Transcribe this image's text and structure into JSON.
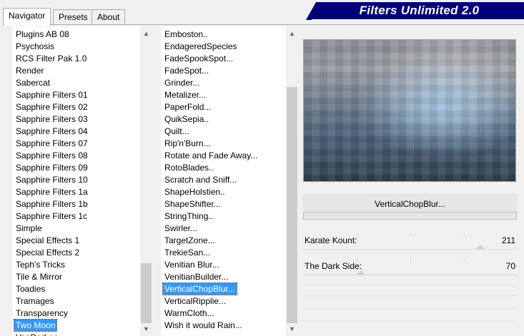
{
  "tabs": [
    {
      "label": "Navigator",
      "active": true
    },
    {
      "label": "Presets",
      "active": false
    },
    {
      "label": "About",
      "active": false
    }
  ],
  "banner": {
    "title": "Filters Unlimited 2.0"
  },
  "categories": {
    "items": [
      "Plugins AB 08",
      "Psychosis",
      "RCS Filter Pak 1.0",
      "Render",
      "Sabercat",
      "Sapphire Filters 01",
      "Sapphire Filters 02",
      "Sapphire Filters 03",
      "Sapphire Filters 04",
      "Sapphire Filters 07",
      "Sapphire Filters 08",
      "Sapphire Filters 09",
      "Sapphire Filters 10",
      "Sapphire Filters 1a",
      "Sapphire Filters 1b",
      "Sapphire Filters 1c",
      "Simple",
      "Special Effects 1",
      "Special Effects 2",
      "Teph's Tricks",
      "Tile & Mirror",
      "Toadies",
      "Tramages",
      "Transparency",
      "Two Moon",
      "VanDerLee"
    ],
    "selected": "Two Moon"
  },
  "filters": {
    "items": [
      "Emboston..",
      "EndageredSpecies",
      "FadeSpookSpot...",
      "FadeSpot...",
      "Grinder...",
      "Metalizer...",
      "PaperFold...",
      "QuikSepia..",
      "Quilt...",
      "Rip'n'Burn...",
      "Rotate and Fade Away...",
      "RotoBlades..",
      "Scratch and Sniff...",
      "ShapeHolstien..",
      "ShapeShifter...",
      "StringThing..",
      "Swirler...",
      "TargetZone...",
      "TrekieSan...",
      "Venitian Blur...",
      "VenitianBuilder...",
      "VerticalChopBlur...",
      "VerticalRipplie...",
      "WarmCloth...",
      "Wish it would Rain..."
    ],
    "selected": "VerticalChopBlur..."
  },
  "current_filter": {
    "name": "VerticalChopBlur...",
    "progress": 0
  },
  "params": [
    {
      "label": "Karate Kount:",
      "value": "211",
      "level": 0.83
    },
    {
      "label": "The Dark Side:",
      "value": "70",
      "level": 0.27
    }
  ],
  "colors": {
    "banner_bg": "#00007a",
    "selection": "#3399ff"
  }
}
